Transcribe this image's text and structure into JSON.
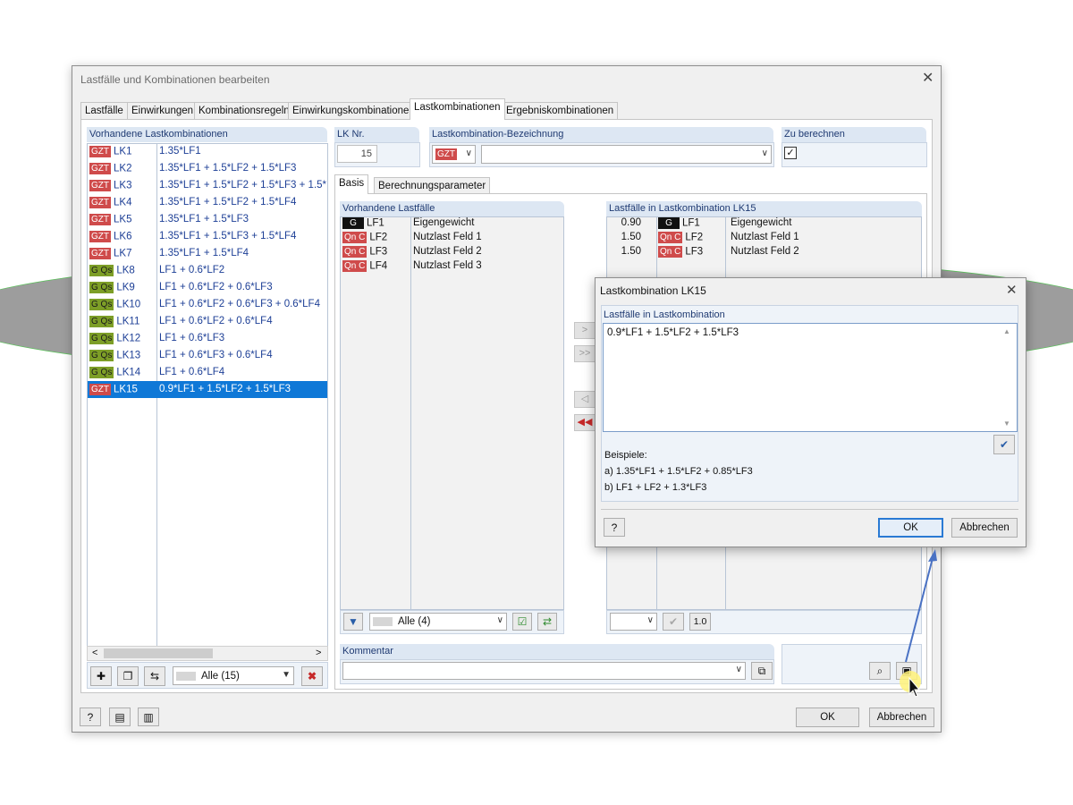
{
  "dialog": {
    "title": "Lastfälle und Kombinationen bearbeiten",
    "tabs": [
      {
        "label": "Lastfälle"
      },
      {
        "label": "Einwirkungen"
      },
      {
        "label": "Kombinationsregeln"
      },
      {
        "label": "Einwirkungskombinationen"
      },
      {
        "label": "Lastkombinationen",
        "active": true
      },
      {
        "label": "Ergebniskombinationen"
      }
    ],
    "ok_label": "OK",
    "cancel_label": "Abbrechen"
  },
  "left_panel": {
    "header": "Vorhandene Lastkombinationen",
    "rows": [
      {
        "badge": "GZT",
        "id": "LK1",
        "formula": "1.35*LF1"
      },
      {
        "badge": "GZT",
        "id": "LK2",
        "formula": "1.35*LF1 + 1.5*LF2 + 1.5*LF3"
      },
      {
        "badge": "GZT",
        "id": "LK3",
        "formula": "1.35*LF1 + 1.5*LF2 + 1.5*LF3 + 1.5*"
      },
      {
        "badge": "GZT",
        "id": "LK4",
        "formula": "1.35*LF1 + 1.5*LF2 + 1.5*LF4"
      },
      {
        "badge": "GZT",
        "id": "LK5",
        "formula": "1.35*LF1 + 1.5*LF3"
      },
      {
        "badge": "GZT",
        "id": "LK6",
        "formula": "1.35*LF1 + 1.5*LF3 + 1.5*LF4"
      },
      {
        "badge": "GZT",
        "id": "LK7",
        "formula": "1.35*LF1 + 1.5*LF4"
      },
      {
        "badge": "G Qs",
        "id": "LK8",
        "formula": "LF1 + 0.6*LF2"
      },
      {
        "badge": "G Qs",
        "id": "LK9",
        "formula": "LF1 + 0.6*LF2 + 0.6*LF3"
      },
      {
        "badge": "G Qs",
        "id": "LK10",
        "formula": "LF1 + 0.6*LF2 + 0.6*LF3 + 0.6*LF4"
      },
      {
        "badge": "G Qs",
        "id": "LK11",
        "formula": "LF1 + 0.6*LF2 + 0.6*LF4"
      },
      {
        "badge": "G Qs",
        "id": "LK12",
        "formula": "LF1 + 0.6*LF3"
      },
      {
        "badge": "G Qs",
        "id": "LK13",
        "formula": "LF1 + 0.6*LF3 + 0.6*LF4"
      },
      {
        "badge": "G Qs",
        "id": "LK14",
        "formula": "LF1 + 0.6*LF4"
      },
      {
        "badge": "GZT",
        "id": "LK15",
        "formula": "0.9*LF1 + 1.5*LF2 + 1.5*LF3",
        "selected": true
      }
    ],
    "filter_value": "Alle (15)"
  },
  "lk_nr": {
    "label": "LK Nr.",
    "value": "15"
  },
  "bezeichnung": {
    "label": "Lastkombination-Bezeichnung",
    "badge": "GZT",
    "value": ""
  },
  "zu_berechnen": {
    "label": "Zu berechnen",
    "checked": true
  },
  "subtabs": [
    {
      "label": "Basis",
      "active": true
    },
    {
      "label": "Berechnungsparameter"
    }
  ],
  "vorhandene_lastfaelle": {
    "header": "Vorhandene Lastfälle",
    "rows": [
      {
        "badge": "G",
        "id": "LF1",
        "name": "Eigengewicht"
      },
      {
        "badge": "Qn C",
        "id": "LF2",
        "name": "Nutzlast Feld 1"
      },
      {
        "badge": "Qn C",
        "id": "LF3",
        "name": "Nutzlast Feld 2"
      },
      {
        "badge": "Qn C",
        "id": "LF4",
        "name": "Nutzlast Feld 3"
      }
    ],
    "filter_value": "Alle (4)"
  },
  "in_lastkombination": {
    "header": "Lastfälle in Lastkombination LK15",
    "rows": [
      {
        "factor": "0.90",
        "badge": "G",
        "id": "LF1",
        "name": "Eigengewicht"
      },
      {
        "factor": "1.50",
        "badge": "Qn C",
        "id": "LF2",
        "name": "Nutzlast Feld 1"
      },
      {
        "factor": "1.50",
        "badge": "Qn C",
        "id": "LF3",
        "name": "Nutzlast Feld 2"
      }
    ],
    "factor_button": "1.0"
  },
  "kommentar": {
    "label": "Kommentar",
    "value": ""
  },
  "popup": {
    "title": "Lastkombination LK15",
    "section_label": "Lastfälle in Lastkombination",
    "formula": "0.9*LF1 + 1.5*LF2 + 1.5*LF3",
    "examples_label": "Beispiele:",
    "example_a": "a)  1.35*LF1 + 1.5*LF2 + 0.85*LF3",
    "example_b": "b)  LF1 + LF2 + 1.3*LF3",
    "ok_label": "OK",
    "cancel_label": "Abbrechen"
  },
  "colors": {
    "gzt": "#cf4b4b",
    "gqs": "#7d9e27",
    "selection": "#0f78d7",
    "header_bg": "#dde7f3",
    "accent_blue": "#2a7ad4"
  }
}
